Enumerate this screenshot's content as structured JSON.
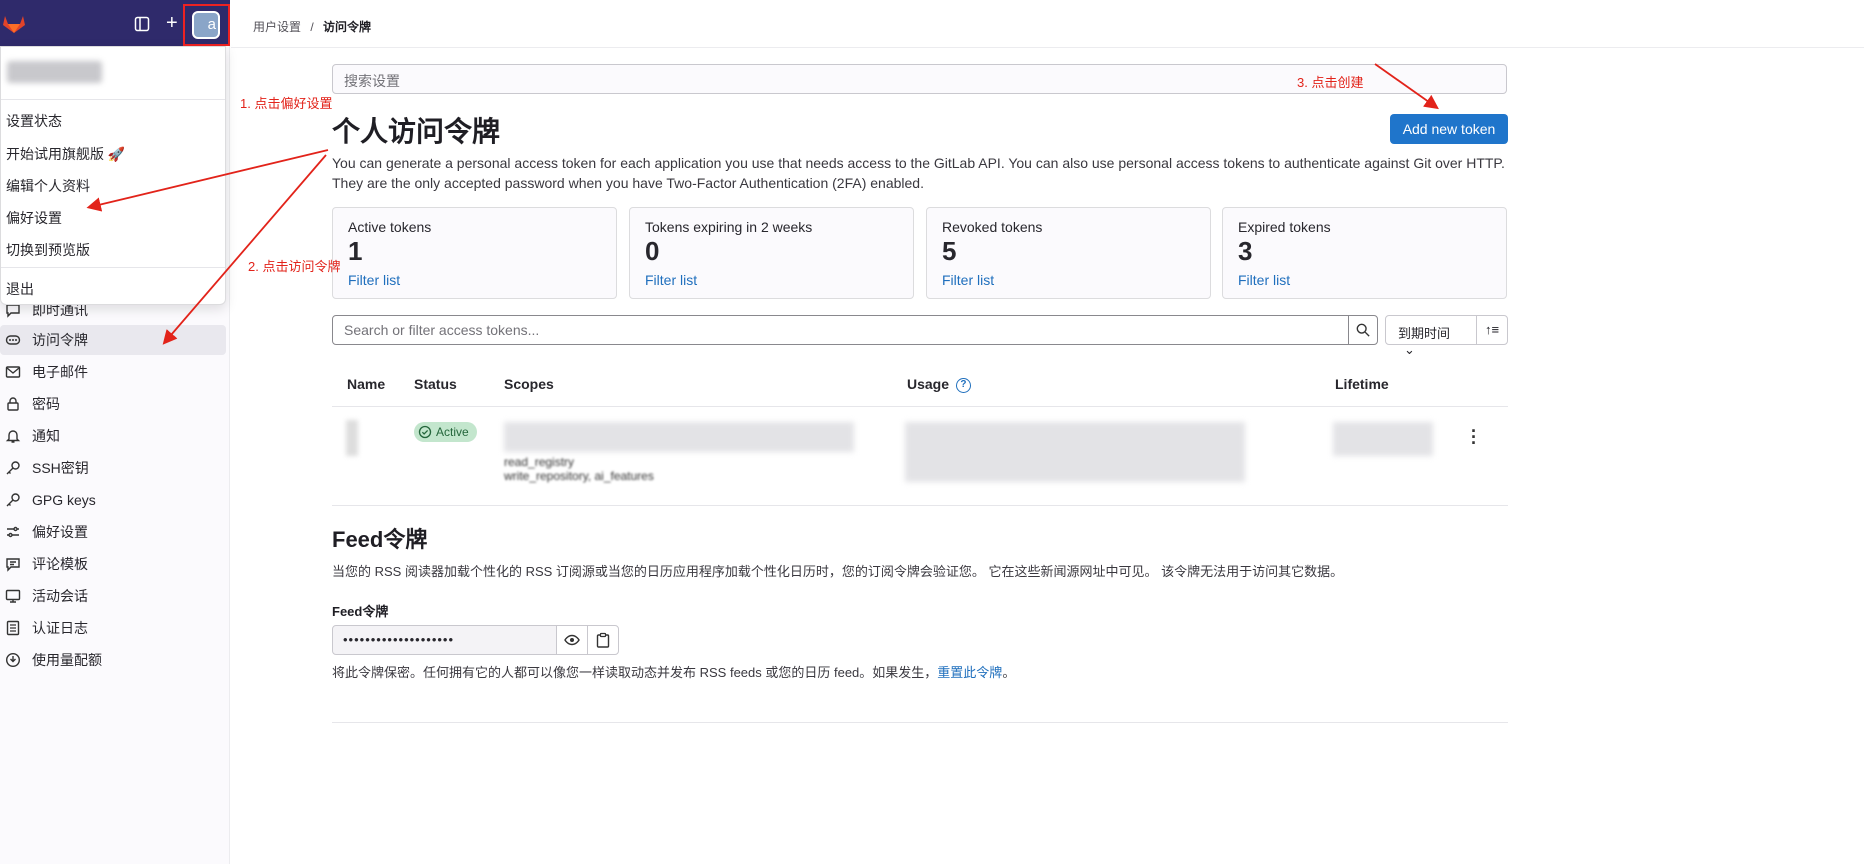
{
  "breadcrumb": {
    "parent": "用户设置",
    "separator": "/",
    "current": "访问令牌"
  },
  "dropdown": {
    "items": [
      "设置状态",
      "开始试用旗舰版 🚀",
      "编辑个人资料",
      "偏好设置",
      "切换到预览版"
    ],
    "signout": "退出"
  },
  "sidebar": {
    "items": [
      {
        "label": "即时通讯",
        "icon": "chat-icon"
      },
      {
        "label": "访问令牌",
        "icon": "token-icon"
      },
      {
        "label": "电子邮件",
        "icon": "mail-icon"
      },
      {
        "label": "密码",
        "icon": "lock-icon"
      },
      {
        "label": "通知",
        "icon": "bell-icon"
      },
      {
        "label": "SSH密钥",
        "icon": "key-icon"
      },
      {
        "label": "GPG keys",
        "icon": "key-icon"
      },
      {
        "label": "偏好设置",
        "icon": "preferences-icon"
      },
      {
        "label": "评论模板",
        "icon": "comment-icon"
      },
      {
        "label": "活动会话",
        "icon": "monitor-icon"
      },
      {
        "label": "认证日志",
        "icon": "log-icon"
      },
      {
        "label": "使用量配额",
        "icon": "quota-icon"
      }
    ]
  },
  "search_settings": {
    "placeholder": "搜索设置"
  },
  "page": {
    "title": "个人访问令牌",
    "add_button": "Add new token",
    "intro_line1": "You can generate a personal access token for each application you use that needs access to the GitLab API. You can also use personal access tokens to authenticate against Git over HTTP.",
    "intro_line2": "They are the only accepted password when you have Two-Factor Authentication (2FA) enabled."
  },
  "stats": [
    {
      "label": "Active tokens",
      "value": "1",
      "link": "Filter list"
    },
    {
      "label": "Tokens expiring in 2 weeks",
      "value": "0",
      "link": "Filter list"
    },
    {
      "label": "Revoked tokens",
      "value": "5",
      "link": "Filter list"
    },
    {
      "label": "Expired tokens",
      "value": "3",
      "link": "Filter list"
    }
  ],
  "filter": {
    "placeholder": "Search or filter access tokens...",
    "sort_label": "到期时间"
  },
  "table": {
    "headers": [
      "Name",
      "Status",
      "Scopes",
      "Usage",
      "Lifetime"
    ],
    "row": {
      "status": "Active",
      "scopes_line3": "read_registry",
      "scopes_line4": "write_repository, ai_features"
    }
  },
  "feed": {
    "title": "Feed令牌",
    "description": "当您的 RSS 阅读器加载个性化的 RSS 订阅源或当您的日历应用程序加载个性化日历时，您的订阅令牌会验证您。 它在这些新闻源网址中可见。 该令牌无法用于访问其它数据。",
    "label": "Feed令牌",
    "masked": "••••••••••••••••••••",
    "help_prefix": "将此令牌保密。任何拥有它的人都可以像您一样读取动态并发布 RSS feeds 或您的日历 feed。如果发生，",
    "help_link": "重置此令牌",
    "help_suffix": "。"
  },
  "annotations": {
    "step1": "1. 点击偏好设置",
    "step2": "2. 点击访问令牌",
    "step3": "3. 点击创建"
  },
  "colors": {
    "topbar": "#2f2a6b",
    "primary_button": "#1f75cb",
    "annotation": "#e2231a",
    "active_badge": "#c3e6cd"
  }
}
